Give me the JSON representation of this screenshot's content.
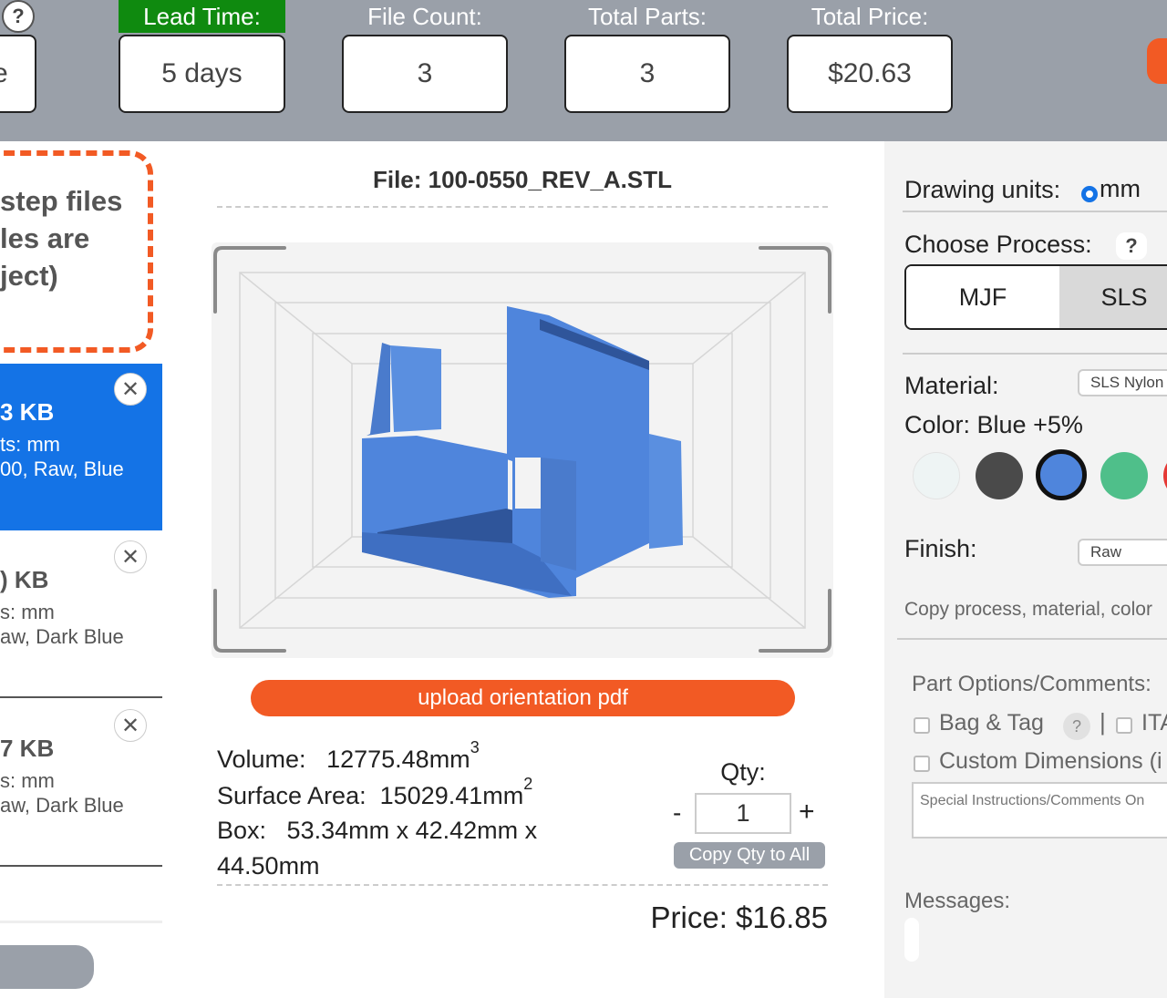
{
  "topbar": {
    "help": "?",
    "partial_left_box": "e",
    "lead_time": {
      "label": "Lead Time:",
      "value": "5 days",
      "label_color": "#0f8a0f"
    },
    "file_count": {
      "label": "File Count:",
      "value": "3"
    },
    "total_parts": {
      "label": "Total Parts:",
      "value": "3"
    },
    "total_price": {
      "label": "Total Price:",
      "value": "$20.63"
    },
    "accent_color": "#f25a24"
  },
  "dropzone": {
    "lines": [
      "step files",
      "les are",
      "ject)"
    ]
  },
  "files": [
    {
      "size": "3 KB",
      "units": "ts: mm",
      "spec": "00, Raw, Blue",
      "active": true
    },
    {
      "size": ") KB",
      "units": "s: mm",
      "spec": "aw, Dark Blue",
      "active": false
    },
    {
      "size": "7 KB",
      "units": "s: mm",
      "spec": "aw, Dark Blue",
      "active": false
    }
  ],
  "viewer": {
    "title": "File: 100-0550_REV_A.STL",
    "model_color": "#4f85dc"
  },
  "upload_label": "upload orientation pdf",
  "metrics": {
    "volume_label": "Volume:",
    "volume_value": "12775.48mm",
    "volume_exp": "3",
    "surface_label": "Surface Area:",
    "surface_value": "15029.41mm",
    "surface_exp": "2",
    "box_label": "Box:",
    "box_value": "53.34mm x 42.42mm x",
    "box_value_2": "44.50mm"
  },
  "qty": {
    "label": "Qty:",
    "minus": "-",
    "plus": "+",
    "value": "1",
    "copy_label": "Copy Qty to All"
  },
  "price_text": "Price: $16.85",
  "settings": {
    "drawing_units_label": "Drawing units:",
    "drawing_units_value": "mm",
    "choose_process_label": "Choose Process:",
    "help": "?",
    "process_options": [
      "MJF",
      "SLS"
    ],
    "selected_process": "SLS",
    "material_label": "Material:",
    "material_value": "SLS Nylon P",
    "color_label": "Color: Blue +5%",
    "swatches": [
      {
        "name": "white",
        "hex": "#eef4f4"
      },
      {
        "name": "dark-gray",
        "hex": "#4a4a4a"
      },
      {
        "name": "blue",
        "hex": "#4f85dc",
        "selected": true
      },
      {
        "name": "green",
        "hex": "#4fbf8a"
      },
      {
        "name": "red",
        "hex": "#e53935"
      }
    ],
    "finish_label": "Finish:",
    "finish_value": "Raw",
    "copy_process_text": "Copy process, material, color",
    "part_options_label": "Part Options/Comments:",
    "bag_tag_label": "Bag & Tag",
    "bag_tag_help": "?",
    "pipe": "|",
    "itar_label": "ITA",
    "custom_dimensions_label": "Custom Dimensions (i",
    "instructions_placeholder": "Special Instructions/Comments On",
    "messages_label": "Messages:"
  }
}
